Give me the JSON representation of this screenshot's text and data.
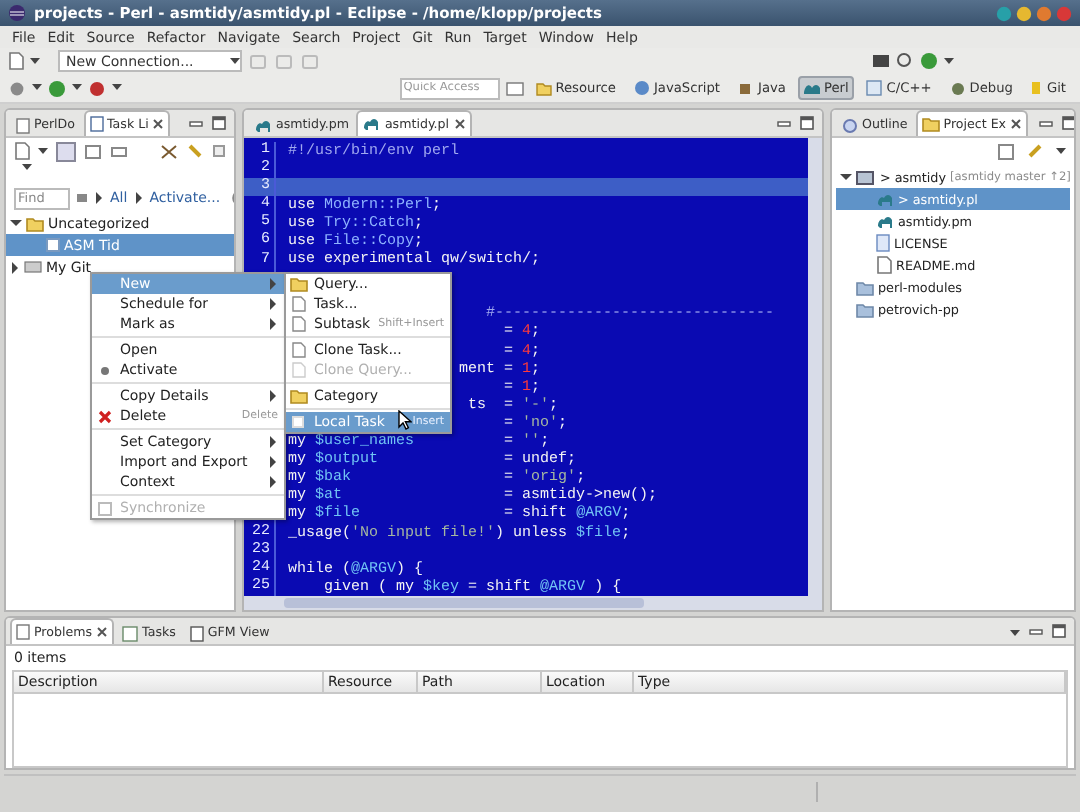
{
  "window": {
    "title": "projects - Perl - asmtidy/asmtidy.pl - Eclipse - /home/klopp/projects"
  },
  "menu_bar": [
    "File",
    "Edit",
    "Source",
    "Refactor",
    "Navigate",
    "Search",
    "Project",
    "Git",
    "Run",
    "Target",
    "Window",
    "Help"
  ],
  "toolbar": {
    "connection_combo": "New Connection...",
    "quick_access": {
      "placeholder": "Quick Access"
    },
    "perspectives": [
      {
        "label": "Resource",
        "selected": false
      },
      {
        "label": "JavaScript",
        "selected": false
      },
      {
        "label": "Java",
        "selected": false
      },
      {
        "label": "Perl",
        "selected": true
      },
      {
        "label": "C/C++",
        "selected": false
      },
      {
        "label": "Debug",
        "selected": false
      },
      {
        "label": "Git",
        "selected": false
      }
    ]
  },
  "task_list_view": {
    "tabs": [
      {
        "label": "PerlDo",
        "selected": false
      },
      {
        "label": "Task Li",
        "selected": true
      }
    ],
    "find": {
      "placeholder": "Find"
    },
    "filters": [
      "All",
      "Activate..."
    ],
    "tree": [
      {
        "label": "Uncategorized",
        "expanded": true,
        "selected": false,
        "children": [
          {
            "label": "ASM Tid",
            "selected": true
          }
        ]
      },
      {
        "label": "My Git",
        "expanded": false,
        "selected": false
      }
    ]
  },
  "editor": {
    "tabs": [
      {
        "label": "asmtidy.pm",
        "selected": false
      },
      {
        "label": "asmtidy.pl",
        "selected": true
      }
    ],
    "lines": [
      {
        "number": "1",
        "code": "#!/usr/bin/env perl",
        "current": false
      },
      {
        "number": "2",
        "current": false
      },
      {
        "number": "3",
        "current": true
      },
      {
        "number": "4",
        "code": "use Modern::Perl;",
        "current": false
      },
      {
        "number": "5",
        "code": "use Try::Catch;",
        "current": false
      },
      {
        "number": "6",
        "code": "use File::Copy;",
        "current": false
      },
      {
        "number": "7",
        "code": "use experimental qw/switch/;",
        "current": false
      },
      {
        "current": false
      },
      {
        "current": false
      },
      {
        "code": "                      #-------------------------------",
        "current": false
      },
      {
        "code": "                        = 4;",
        "current": false
      },
      {
        "code": "                        = 4;",
        "current": false
      },
      {
        "code": "                   ment = 1;",
        "current": false
      },
      {
        "code": "                        = 1;",
        "current": false
      },
      {
        "code": "                    ts  = '-';",
        "current": false
      },
      {
        "code": "                        = 'no';",
        "current": false
      },
      {
        "code": "my $user_names          = '';",
        "current": false
      },
      {
        "code": "my $output              = undef;",
        "current": false
      },
      {
        "code": "my $bak                 = 'orig';",
        "current": false
      },
      {
        "code": "my $at                  = asmtidy->new();",
        "current": false
      },
      {
        "code": "my $file                = shift @ARGV;",
        "current": false
      },
      {
        "number": "22",
        "code": "_usage('No input file!') unless $file;",
        "current": false
      },
      {
        "number": "23",
        "current": false
      },
      {
        "number": "24",
        "code": "while (@ARGV) {",
        "current": false
      },
      {
        "number": "25",
        "code": "    given ( my $key = shift @ARGV ) {",
        "current": false
      }
    ]
  },
  "project_view": {
    "tabs": [
      {
        "label": "Outline",
        "selected": false
      },
      {
        "label": "Project Ex",
        "selected": true
      }
    ],
    "tree": [
      {
        "label": "> asmtidy",
        "decoration": "[asmtidy master ↑2]",
        "expanded": true,
        "selected": false,
        "children": [
          {
            "label": "> asmtidy.pl",
            "selected": true
          },
          {
            "label": "asmtidy.pm",
            "selected": false
          },
          {
            "label": "LICENSE",
            "selected": false
          },
          {
            "label": "README.md",
            "selected": false
          }
        ]
      },
      {
        "label": "perl-modules",
        "selected": false
      },
      {
        "label": "petrovich-pp",
        "selected": false
      }
    ]
  },
  "context_menu": {
    "items": [
      {
        "kind": "item",
        "label": "New",
        "submenu": true,
        "selected": true,
        "disabled": false
      },
      {
        "kind": "item",
        "label": "Schedule for",
        "submenu": true,
        "selected": false,
        "disabled": false
      },
      {
        "kind": "item",
        "label": "Mark as",
        "submenu": true,
        "selected": false,
        "disabled": false
      },
      {
        "kind": "separator"
      },
      {
        "kind": "item",
        "label": "Open",
        "submenu": false,
        "selected": false,
        "disabled": false
      },
      {
        "kind": "item",
        "label": "Activate",
        "submenu": false,
        "selected": false,
        "disabled": false
      },
      {
        "kind": "separator"
      },
      {
        "kind": "item",
        "label": "Copy Details",
        "submenu": true,
        "selected": false,
        "disabled": false
      },
      {
        "kind": "item",
        "label": "Delete",
        "shortcut": "Delete",
        "submenu": false,
        "selected": false,
        "disabled": false
      },
      {
        "kind": "separator"
      },
      {
        "kind": "item",
        "label": "Set Category",
        "submenu": true,
        "selected": false,
        "disabled": false
      },
      {
        "kind": "item",
        "label": "Import and Export",
        "submenu": true,
        "selected": false,
        "disabled": false
      },
      {
        "kind": "item",
        "label": "Context",
        "submenu": true,
        "selected": false,
        "disabled": false
      },
      {
        "kind": "separator"
      },
      {
        "kind": "item",
        "label": "Synchronize",
        "submenu": false,
        "selected": false,
        "disabled": true
      }
    ],
    "submenu": [
      {
        "kind": "item",
        "label": "Query...",
        "selected": false,
        "disabled": false
      },
      {
        "kind": "item",
        "label": "Task...",
        "selected": false,
        "disabled": false
      },
      {
        "kind": "item",
        "label": "Subtask",
        "shortcut": "Shift+Insert",
        "selected": false,
        "disabled": false
      },
      {
        "kind": "separator"
      },
      {
        "kind": "item",
        "label": "Clone Task...",
        "selected": false,
        "disabled": false
      },
      {
        "kind": "item",
        "label": "Clone Query...",
        "selected": false,
        "disabled": true
      },
      {
        "kind": "separator"
      },
      {
        "kind": "item",
        "label": "Category",
        "selected": false,
        "disabled": false
      },
      {
        "kind": "separator"
      },
      {
        "kind": "item",
        "label": "Local Task",
        "shortcut": "Insert",
        "selected": true,
        "disabled": false
      }
    ]
  },
  "bottom_panel": {
    "tabs": [
      {
        "label": "Problems",
        "selected": true
      },
      {
        "label": "Tasks",
        "selected": false
      },
      {
        "label": "GFM View",
        "selected": false
      }
    ],
    "summary": "0 items",
    "columns": [
      "Description",
      "Resource",
      "Path",
      "Location",
      "Type"
    ]
  }
}
